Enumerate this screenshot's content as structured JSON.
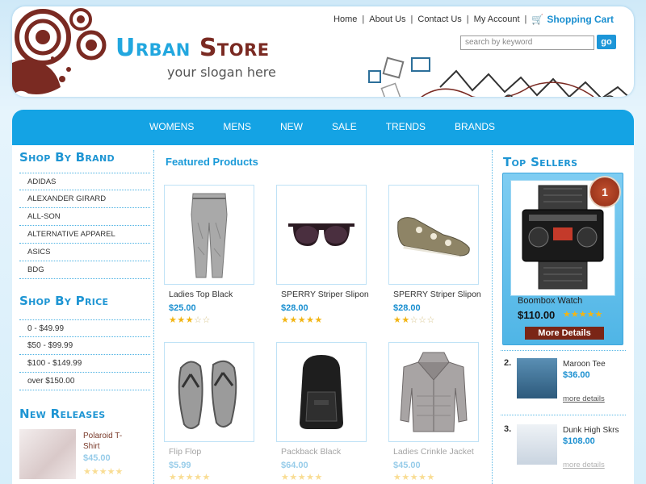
{
  "header": {
    "logo_word1": "Urban",
    "logo_word2": "Store",
    "slogan": "your slogan here",
    "topnav": [
      "Home",
      "About Us",
      "Contact Us",
      "My Account"
    ],
    "cart_label": "Shopping Cart",
    "search": {
      "placeholder": "search by keyword",
      "button_label": "go"
    }
  },
  "mainnav": [
    "WOMENS",
    "MENS",
    "NEW",
    "SALE",
    "TRENDS",
    "BRANDS"
  ],
  "left": {
    "brand_title": "Shop By Brand",
    "brands": [
      "ADIDAS",
      "ALEXANDER GIRARD",
      "ALL-SON",
      "ALTERNATIVE APPAREL",
      "ASICS",
      "BDG"
    ],
    "price_title": "Shop By Price",
    "prices": [
      "0 - $49.99",
      "$50 - $99.99",
      "$100 - $149.99",
      "over $150.00"
    ],
    "new_title": "New Releases",
    "new_item": {
      "name": "Polaroid T-Shirt",
      "price": "$45.00",
      "rating": 5
    }
  },
  "center": {
    "title": "Featured Products",
    "products": [
      {
        "name": "Ladies Top Black",
        "price": "$25.00",
        "rating": 3,
        "icon": "pants-icon"
      },
      {
        "name": "SPERRY Striper Slipon",
        "price": "$28.00",
        "rating": 5,
        "icon": "sunglasses-icon"
      },
      {
        "name": "SPERRY Striper Slipon",
        "price": "$28.00",
        "rating": 2,
        "icon": "shoe-icon"
      },
      {
        "name": "Flip Flop",
        "price": "$5.99",
        "rating": 5,
        "icon": "flipflop-icon"
      },
      {
        "name": "Packback Black",
        "price": "$64.00",
        "rating": 5,
        "icon": "backpack-icon"
      },
      {
        "name": "Ladies Crinkle Jacket",
        "price": "$45.00",
        "rating": 5,
        "icon": "jacket-icon"
      }
    ]
  },
  "right": {
    "title": "Top Sellers",
    "top": {
      "rank": "1",
      "name": "Boombox Watch",
      "price": "$110.00",
      "rating": 5,
      "button": "More Details"
    },
    "items": [
      {
        "rank": "2.",
        "name": "Maroon Tee",
        "price": "$36.00",
        "more": "more details"
      },
      {
        "rank": "3.",
        "name": "Dunk High Skrs",
        "price": "$108.00",
        "more": "more details"
      }
    ]
  },
  "colors": {
    "accent": "#14a3e4",
    "brand_dark": "#7a2a22",
    "star": "#f2b514"
  }
}
